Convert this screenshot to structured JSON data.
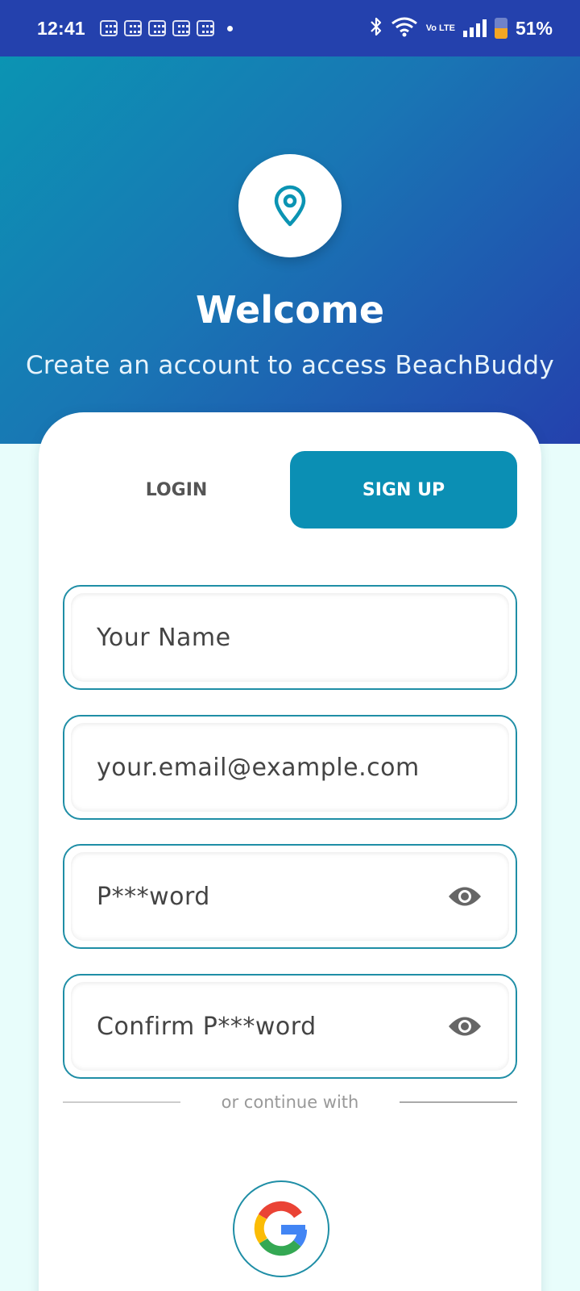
{
  "status_bar": {
    "time": "12:41",
    "battery_percent": "51%",
    "battery_level": 0.51,
    "volte": "Vo LTE",
    "icons": [
      "notification-icon",
      "notification-icon",
      "notification-icon",
      "notification-icon",
      "notification-icon",
      "bluetooth-icon",
      "wifi-icon",
      "signal-icon",
      "battery-icon"
    ]
  },
  "header": {
    "title": "Welcome",
    "subtitle": "Create an account to access BeachBuddy",
    "logo_icon": "location-pin-icon"
  },
  "tabs": [
    {
      "label": "LOGIN",
      "active": false
    },
    {
      "label": "SIGN UP",
      "active": true
    }
  ],
  "form": {
    "name_placeholder": "Your Name",
    "email_placeholder": "your.email@example.com",
    "password_placeholder": "P***word",
    "confirm_placeholder": "Confirm P***word"
  },
  "divider_text": "or continue with",
  "social": {
    "google_icon": "google-icon"
  },
  "colors": {
    "status_bar": "#2441ad",
    "header_start": "#0b94b3",
    "header_end": "#2441ad",
    "accent": "#0b8fb4",
    "page_bg": "#e8fdfb"
  }
}
